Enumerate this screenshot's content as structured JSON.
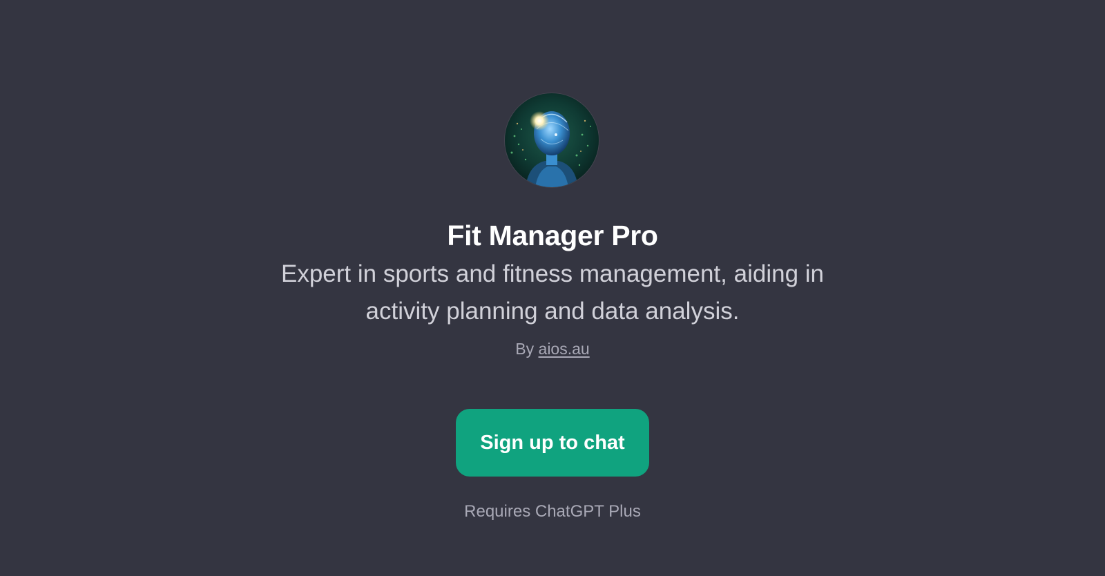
{
  "gpt": {
    "avatar_icon": "ai-humanoid-avatar-icon",
    "title": "Fit Manager Pro",
    "description": "Expert in sports and fitness management, aiding in activity planning and data analysis.",
    "byline_prefix": "By",
    "author_link": "aios.au"
  },
  "actions": {
    "signup_label": "Sign up to chat"
  },
  "footer": {
    "requirement": "Requires ChatGPT Plus"
  },
  "colors": {
    "background": "#343541",
    "accent": "#10a37f",
    "title_text": "#ffffff",
    "muted_text": "#a9a9b6"
  }
}
